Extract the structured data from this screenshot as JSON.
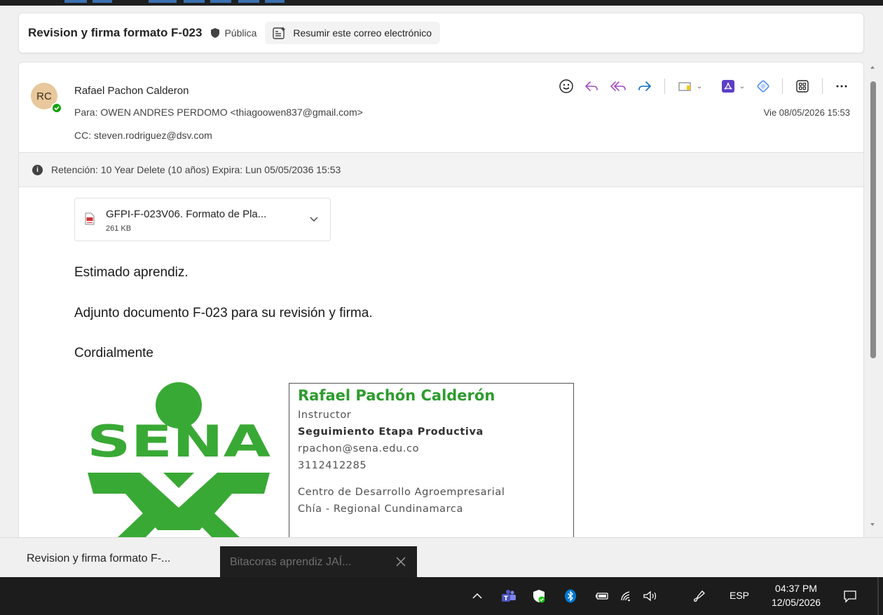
{
  "subject": {
    "title": "Revision y firma formato F-023",
    "sensitivity": "Pública",
    "summarize_label": "Resumir este correo electrónico"
  },
  "message": {
    "avatar_initials": "RC",
    "sender": "Rafael Pachon Calderon",
    "to": "Para:  OWEN ANDRES PERDOMO <thiagoowen837@gmail.com>",
    "cc": "CC:  steven.rodriguez@dsv.com",
    "date": "Vie 08/05/2026 15:53",
    "retention": "Retención: 10 Year Delete (10 años) Expira: Lun 05/05/2036 15:53",
    "attachment": {
      "name": "GFPI-F-023V06. Formato de Pla...",
      "size": "261 KB"
    },
    "body": {
      "greeting": "Estimado aprendiz.",
      "line1": "Adjunto documento F-023 para su revisión y firma.",
      "closing": "Cordialmente"
    },
    "signature": {
      "logo_text": "SENA",
      "name": "Rafael Pachón Calderón",
      "role": "Instructor",
      "area": "Seguimiento Etapa Productiva",
      "email": "rpachon@sena.edu.co",
      "phone": "3112412285",
      "center": "Centro de Desarrollo Agroempresarial",
      "region": "Chía - Regional Cundinamarca"
    }
  },
  "toolbar_icons": [
    "emoji-icon",
    "reply-icon",
    "reply-all-icon",
    "forward-icon",
    "tag-icon",
    "pdf-app-icon",
    "loop-icon",
    "apps-icon",
    "more-icon"
  ],
  "window_tabs": {
    "active": "Revision y firma formato F-...",
    "other": "Bitacoras aprendiz JAÍ..."
  },
  "taskbar": {
    "language": "ESP",
    "time": "04:37 PM",
    "date": "12/05/2026"
  },
  "colors": {
    "brand_green": "#39a935",
    "signature_green": "#2e9c2e",
    "reply_purple": "#a34dc4",
    "accent_blue": "#0f6cbd"
  }
}
